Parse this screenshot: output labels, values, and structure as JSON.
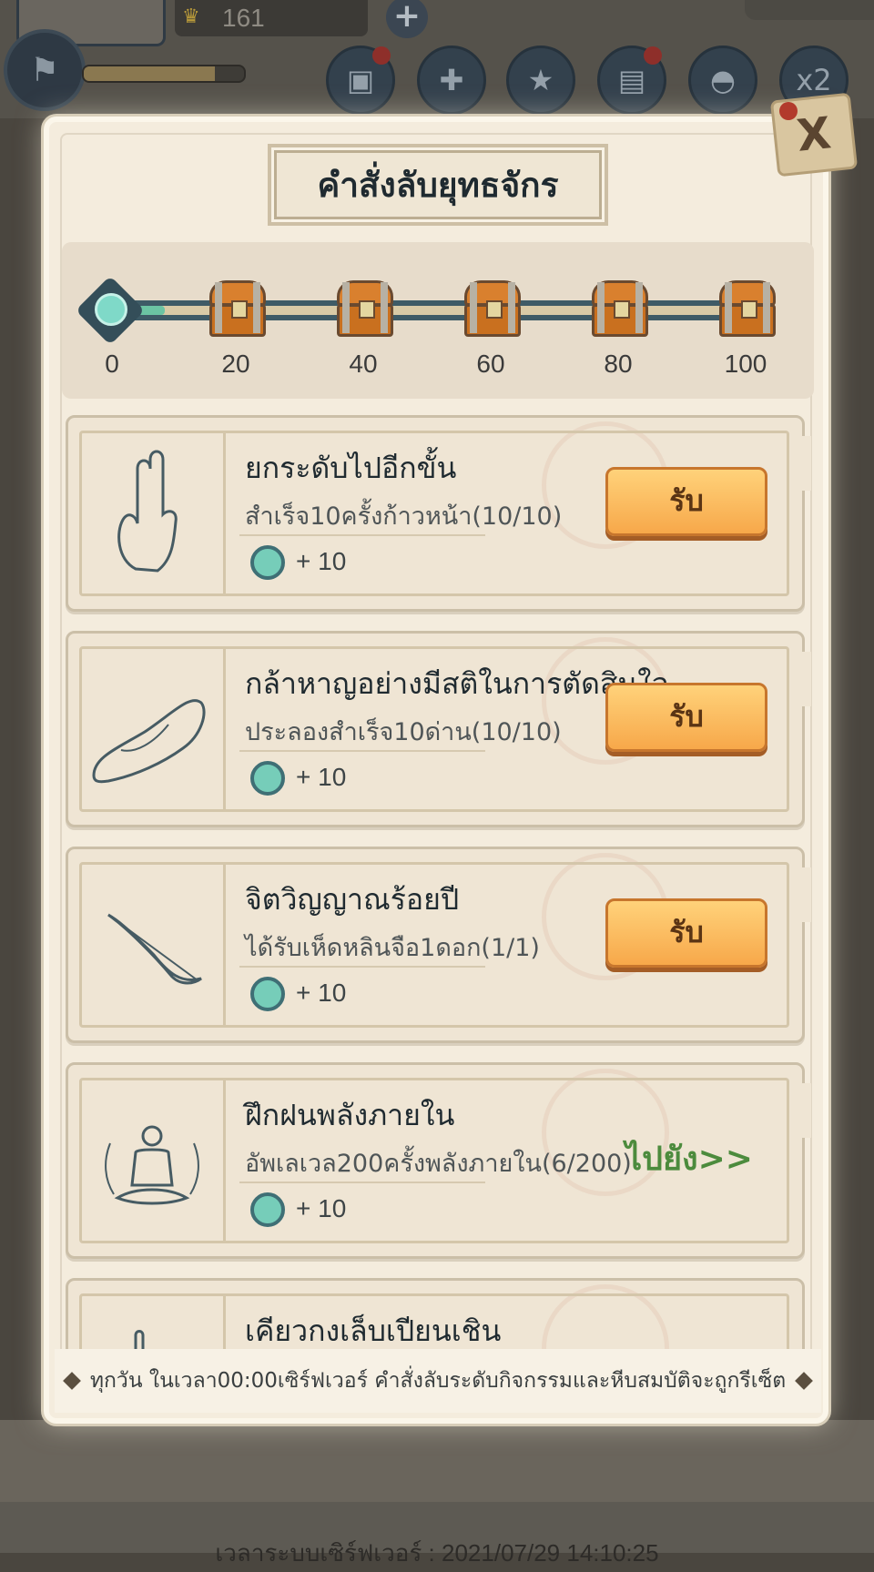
{
  "hud": {
    "gold_value": "161",
    "top_icons": [
      "treasure-chest-icon",
      "gift-icon",
      "badge-icon",
      "scroll-icon",
      "helmet-icon",
      "speed-x2-icon"
    ],
    "speed_label": "x2",
    "exp_progress": 0.82
  },
  "panel": {
    "title": "คำสั่งลับยุทธจักร",
    "close_label": "X"
  },
  "progress": {
    "current": 0,
    "max": 100,
    "fill_fraction": 0.08,
    "milestones": [
      "0",
      "20",
      "40",
      "60",
      "80",
      "100"
    ]
  },
  "tasks": [
    {
      "title": "ยกระดับไปอีกขั้น",
      "subtitle": "สำเร็จ10ครั้งก้าวหน้า(10/10)",
      "reward": "+ 10",
      "action": "รับ",
      "action_type": "claim",
      "icon": "hand-gesture-icon"
    },
    {
      "title": "กล้าหาญอย่างมีสติในการตัดสินใจ",
      "subtitle": "ประลองสำเร็จ10ด่าน(10/10)",
      "reward": "+ 10",
      "action": "รับ",
      "action_type": "claim",
      "icon": "shoe-icon"
    },
    {
      "title": "จิตวิญญาณร้อยปี",
      "subtitle": "ได้รับเห็ดหลินจือ1ดอก(1/1)",
      "reward": "+ 10",
      "action": "รับ",
      "action_type": "claim",
      "icon": "feather-icon"
    },
    {
      "title": "ฝึกฝนพลังภายใน",
      "subtitle": "อัพเลเวล200ครั้งพลังภายใน(6/200)",
      "reward": "+ 10",
      "action": "ไปยัง>>",
      "action_type": "goto",
      "icon": "meditation-icon"
    },
    {
      "title": "เคียวกงเล็บเปียนเชิน",
      "subtitle": "",
      "reward": "",
      "action": "",
      "action_type": "none",
      "icon": "hand-icon"
    }
  ],
  "footer_note": "ทุกวัน ในเวลา00:00เซิร์ฟเวอร์ คำสั่งลับระดับกิจกรรมและหีบสมบัติจะถูกรีเซ็ต",
  "server_time": "เวลาระบบเซิร์ฟเวอร์ : 2021/07/29 14:10:25",
  "colors": {
    "panel_bg": "#f4ecdd",
    "claim_button": "#f7a84a",
    "goto_link": "#4c8b3d",
    "track": "#3e5b66",
    "track_fill": "#6bc4a3"
  }
}
